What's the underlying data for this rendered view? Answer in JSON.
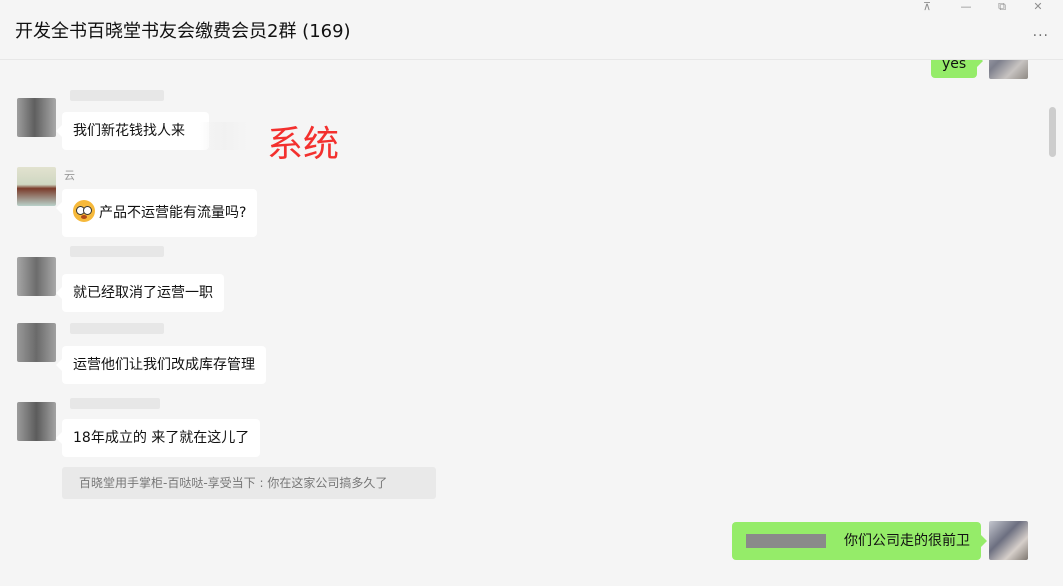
{
  "window": {
    "title": "开发全书百晓堂书友会缴费会员2群 (169)",
    "controls": {
      "pin": "⊼",
      "minimize": "—",
      "maximize": "⧉",
      "close": "✕"
    },
    "more_label": "···"
  },
  "messages": [
    {
      "text": "yes",
      "sender": "me"
    },
    {
      "text": "我们新花钱找人来",
      "sender": "other"
    },
    {
      "sender_name": "云",
      "text": "产品不运营能有流量吗?",
      "emoji": "surprised-face"
    },
    {
      "text": "就已经取消了运营一职",
      "sender": "other"
    },
    {
      "text": "运营他们让我们改成库存管理",
      "sender": "other"
    },
    {
      "text": "18年成立的 来了就在这儿了",
      "sender": "other"
    },
    {
      "text": "你们公司走的很前卫",
      "sender": "me"
    }
  ],
  "quote": {
    "text": "百晓堂用手掌柜-百哒哒-享受当下 : 你在这家公司搞多久了"
  },
  "annotation": {
    "text": "系统",
    "color": "#f3302e"
  },
  "colors": {
    "my_bubble": "#95ec69",
    "other_bubble": "#ffffff",
    "background": "#f5f5f5"
  }
}
